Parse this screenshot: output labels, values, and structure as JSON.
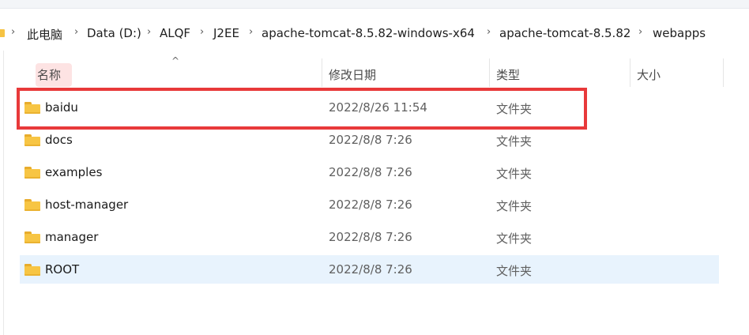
{
  "breadcrumb": [
    "此电脑",
    "Data (D:)",
    "ALQF",
    "J2EE",
    "apache-tomcat-8.5.82-windows-x64",
    "apache-tomcat-8.5.82",
    "webapps"
  ],
  "breadcrumb_separator": "›",
  "columns": {
    "name": "名称",
    "date": "修改日期",
    "type": "类型",
    "size": "大小"
  },
  "sort_indicator": "^",
  "files": [
    {
      "name": "baidu",
      "date": "2022/8/26 11:54",
      "type": "文件夹"
    },
    {
      "name": "docs",
      "date": "2022/8/8 7:26",
      "type": "文件夹"
    },
    {
      "name": "examples",
      "date": "2022/8/8 7:26",
      "type": "文件夹"
    },
    {
      "name": "host-manager",
      "date": "2022/8/8 7:26",
      "type": "文件夹"
    },
    {
      "name": "manager",
      "date": "2022/8/8 7:26",
      "type": "文件夹"
    },
    {
      "name": "ROOT",
      "date": "2022/8/8 7:26",
      "type": "文件夹"
    }
  ],
  "selected_file": "ROOT",
  "highlighted_file": "baidu",
  "colors": {
    "folder": "#f7c544",
    "highlight_box": "#e8393a",
    "selection": "#e8f3fd"
  },
  "icons": {
    "folder": "folder-icon",
    "separator": "chevron-right-icon"
  }
}
